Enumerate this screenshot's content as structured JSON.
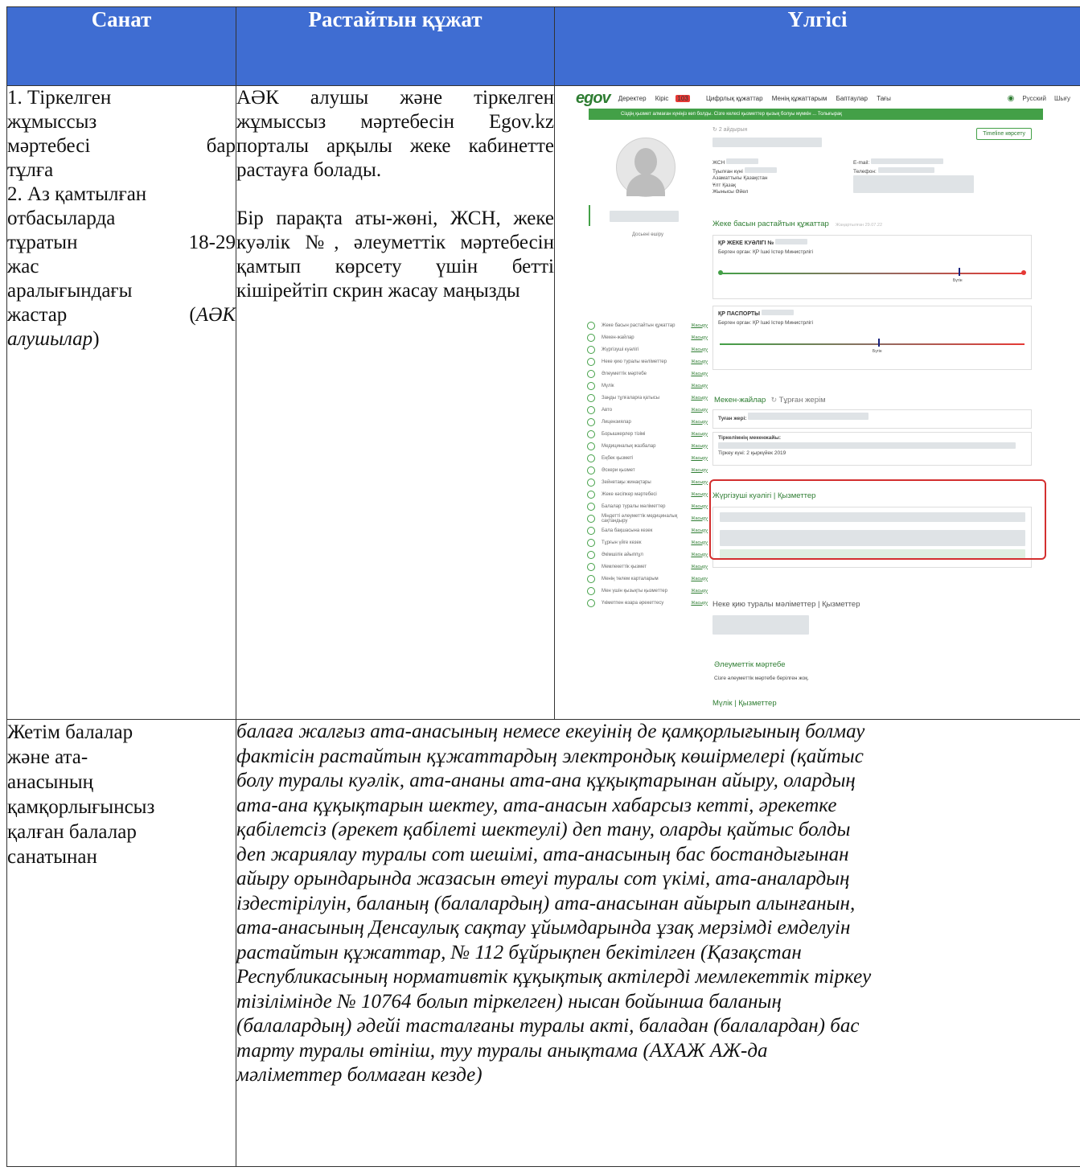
{
  "header": {
    "col1": "Санат",
    "col2": "Растайтын құжат",
    "col3": "Үлгісі"
  },
  "row1": {
    "category": {
      "l1": "1. Тіркелген",
      "l2": "жұмыссыз",
      "l3a": "мәртебесі",
      "l3b": "бар",
      "l4": "тұлға",
      "l5": "2. Аз қамтылған",
      "l6": "отбасыларда",
      "l7a": "тұратын",
      "l7b": "18-29",
      "l8": "жас",
      "l9": "аралығындағы",
      "l10a": "жастар",
      "l10b": "(",
      "l10c": "АӘК",
      "l11a": "алушылар",
      "l11b": ")"
    },
    "document": {
      "p1": "АӘК алушы және тіркелген жұмыссыз мәртебесін Egov.kz порталы арқылы жеке кабинетте растауға болады.",
      "p2": "Бір парақта аты-жөні, ЖСН, жеке куәлік №, әлеуметтік мәртебесін қамтып көрсету үшін бетті кішірейтіп скрин жасау маңызды"
    },
    "example": {
      "logo": "egov",
      "nav": [
        "Деректер",
        "Кіріс",
        "Цифрлық құжаттар",
        "Менің құжаттарым",
        "Баптаулар",
        "Тағы"
      ],
      "nav_badge": "103",
      "lang": "Русский",
      "logout": "Шығу",
      "banner": "Сіздің қызмет алмаған күніңіз көп болды. Сізге келесі қызметтер қызық болуы мүмкін ... Толығырақ",
      "timeline_btn": "Timeline көрсету",
      "ago": "2 айдырын",
      "profile_labels": {
        "iin": "ЖСН",
        "birth": "Туылған күні",
        "citizen": "Азаматтығы",
        "citizen_val": "Қазақстан",
        "nation": "Ұлт",
        "nation_val": "Қазақ",
        "sex": "Жынысы",
        "sex_val": "Әйел",
        "email": "E-mail:",
        "phone": "Телефон:"
      },
      "sidebar_logout": "Досьені өшіру",
      "sidebar": [
        "Жеке басын растайтын құжаттар",
        "Мекен-жайлар",
        "Жүргізуші куәлігі",
        "Неке қию туралы мәліметтер",
        "Әлеуметтік мәртебе",
        "Мүлік",
        "Заңды тұлғаларға қатысы",
        "Авто",
        "Лицензиялар",
        "Борышкерлер тізімі",
        "Медициналық жазбалар",
        "Еңбек қызметі",
        "Әскери қызмет",
        "Зейнетақы жинақтары",
        "Жеке кәсіпкер мәртебесі",
        "Балалар туралы мәліметтер",
        "Міндетті әлеуметтік медициналық сақтандыру",
        "Бала бақшасына кезек",
        "Тұрғын үйге кезек",
        "Әкімшілік айыппұл",
        "Мемлекеттік қызмет",
        "Менің төлем карталарым",
        "Мен үшін қызықты қызметтер",
        "Үкіметпен өзара әрекеттесу"
      ],
      "sidebar_link": "Жасыру",
      "id_section": "Жеке басын растайтын құжаттар",
      "id_updated": "Жаңартылған 29.07.22",
      "id_card_title": "ҚР ЖЕКЕ КУӘЛІГІ №",
      "id_card_org": "Берген орган: ҚР Ішкі Істер Министрлігі",
      "today": "Бүгін",
      "passport_title": "ҚР ПАСПОРТЫ",
      "passport_org": "Берген орган: ҚР Ішкі Істер Министрлігі",
      "address_section": "Мекен-жайлар",
      "address_sub": "Тұрған жерім",
      "birth_place": "Туған жері:",
      "reg_address": "Тіркелімнің мекенжайы:",
      "reg_date": "Тіркеу күні: 2 қыркүйек 2019",
      "driver_section": "Жүргізуші куәлігі | Қызметтер",
      "marriage_section": "Неке қию туралы мәліметтер | Қызметтер",
      "social_section": "Әлеуметтік мәртебе",
      "social_text": "Сізге әлеуметтік мәртебе берілген жоқ.",
      "property_section": "Мүлік | Қызметтер"
    }
  },
  "row2": {
    "category": [
      "Жетім балалар",
      "және ата-",
      "анасының",
      "қамқорлығынсыз",
      "қалған балалар",
      "санатынан"
    ],
    "document_lines": [
      "балаға жалғыз ата-анасының немесе екеуінің де қамқорлығының болмау",
      "фактісін растайтын құжаттардың электрондық көшірмелері (қайтыс",
      "болу туралы куәлік, ата-ананы ата-ана құқықтарынан айыру, олардың",
      "ата-ана құқықтарын шектеу, ата-анасын хабарсыз кетті, әрекетке",
      "қабілетсіз (әрекет қабілеті шектеулі) деп тану, оларды қайтыс болды",
      "деп жариялау туралы сот шешімі, ата-анасының бас бостандығынан",
      "айыру орындарында жазасын өтеуі туралы сот үкімі, ата-аналардың",
      "іздестірілуін, баланың (балалардың) ата-анасынан айырып алынғанын,",
      "ата-анасының Денсаулық сақтау ұйымдарында ұзақ мерзімді емделуін",
      "растайтын құжаттар, № 112 бұйрықпен бекітілген (Қазақстан",
      "Республикасының нормативтік құқықтық актілерді мемлекеттік тіркеу",
      "тізілімінде № 10764 болып тіркелген) нысан бойынша баланың",
      "(балалардың) әдейі тасталғаны туралы акті, баладан (балалардан) бас",
      "тарту туралы өтініш, туу туралы анықтама (АХАЖ АЖ-да",
      "мәліметтер болмаған кезде)"
    ]
  }
}
